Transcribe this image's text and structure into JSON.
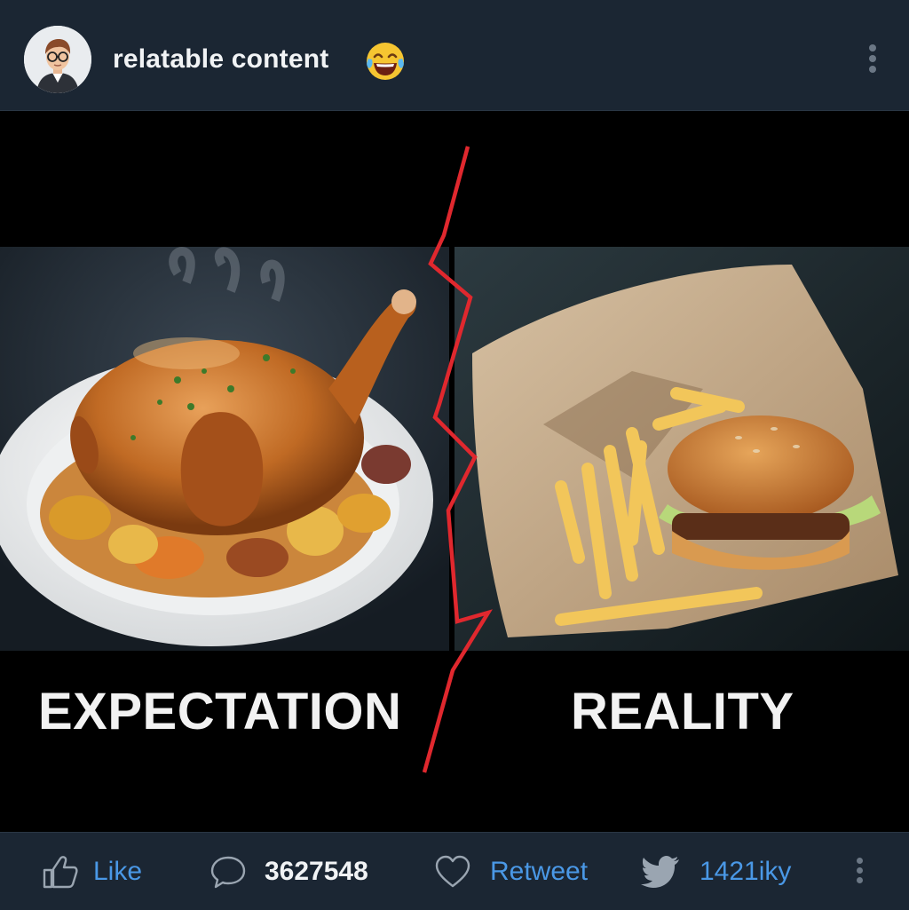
{
  "post": {
    "author_title": "relatable content",
    "title_emoji": "laughing-tears-emoji"
  },
  "meme": {
    "left_caption": "EXPECTATION",
    "right_caption": "REALITY",
    "left_image": "roast-chicken-plate-photo",
    "right_image": "burger-fries-bag-photo",
    "divider_color": "#e0282e"
  },
  "actions": {
    "like_label": "Like",
    "comment_count": "3627548",
    "retweet_label": "Retweet",
    "share_count": "1421iky"
  },
  "colors": {
    "background": "#1b2633",
    "accent": "#4a98e6",
    "text": "#f1f3f5"
  },
  "icons": [
    "avatar-icon",
    "laughing-emoji-icon",
    "more-vertical-icon",
    "thumbs-up-icon",
    "comment-bubble-icon",
    "heart-icon",
    "bird-icon",
    "more-vertical-icon"
  ]
}
